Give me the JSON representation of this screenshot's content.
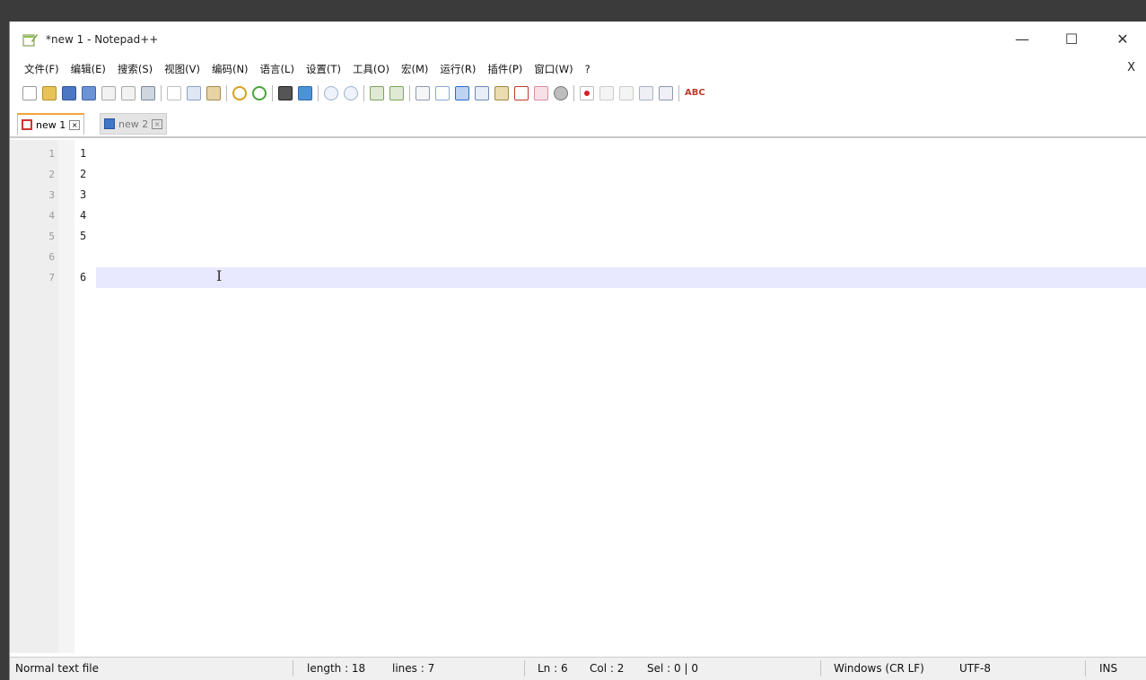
{
  "window": {
    "title": "*new 1 - Notepad++",
    "minimize_glyph": "—",
    "maximize_glyph": "☐",
    "close_glyph": "✕"
  },
  "menu": {
    "items": [
      "文件(F)",
      "编辑(E)",
      "搜索(S)",
      "视图(V)",
      "编码(N)",
      "语言(L)",
      "设置(T)",
      "工具(O)",
      "宏(M)",
      "运行(R)",
      "插件(P)",
      "窗口(W)",
      "?"
    ],
    "close_label": "X"
  },
  "tabs": [
    {
      "label": "new 1",
      "state": "active",
      "icon": "save-unsaved-icon"
    },
    {
      "label": "new 2",
      "state": "inactive",
      "icon": "save-saved-icon"
    }
  ],
  "editor": {
    "line_numbers": [
      "1",
      "2",
      "3",
      "4",
      "5",
      "6",
      "7"
    ],
    "lines": [
      "1",
      "2",
      "3",
      "4",
      "5",
      "6"
    ],
    "current_line": 6,
    "caret_glyph": "I"
  },
  "statusbar": {
    "file_type": "Normal text file",
    "length": "length : 18",
    "lines": "lines : 7",
    "ln": "Ln : 6",
    "col": "Col : 2",
    "sel": "Sel : 0 | 0",
    "eol": "Windows (CR LF)",
    "encoding": "UTF-8",
    "mode": "INS"
  },
  "colors": {
    "current_line": "#e8e8ff",
    "active_tab_accent": "#f3a33a",
    "gutter_bg": "#eeeeee"
  }
}
